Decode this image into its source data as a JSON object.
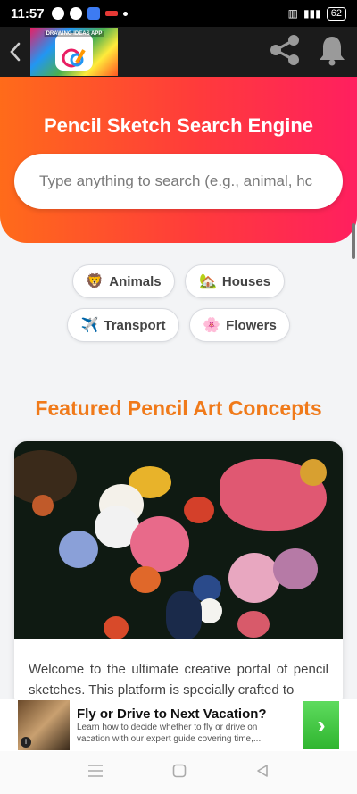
{
  "status": {
    "time": "11:57",
    "battery": "62"
  },
  "appbar": {
    "logo_text": "DRAWING IDEAS APP"
  },
  "hero": {
    "title": "Pencil Sketch Search Engine",
    "search_placeholder": "Type anything to search (e.g., animal, hc"
  },
  "chips": [
    {
      "emoji": "🦁",
      "label": "Animals"
    },
    {
      "emoji": "🏡",
      "label": "Houses"
    },
    {
      "emoji": "✈️",
      "label": "Transport"
    },
    {
      "emoji": "🌸",
      "label": "Flowers"
    }
  ],
  "featured": {
    "title": "Featured Pencil Art Concepts",
    "card_text": "Welcome to the ultimate creative portal of pencil sketches. This platform is specially crafted to"
  },
  "ad": {
    "title": "Fly or Drive to Next Vacation?",
    "description": "Learn how to decide whether to fly or drive on vacation with our expert guide covering time,...",
    "info": "i",
    "go": "›"
  },
  "colors": {
    "hero_start": "#ff6b1a",
    "hero_end": "#ff1f5f",
    "section_title": "#f07a1a"
  }
}
